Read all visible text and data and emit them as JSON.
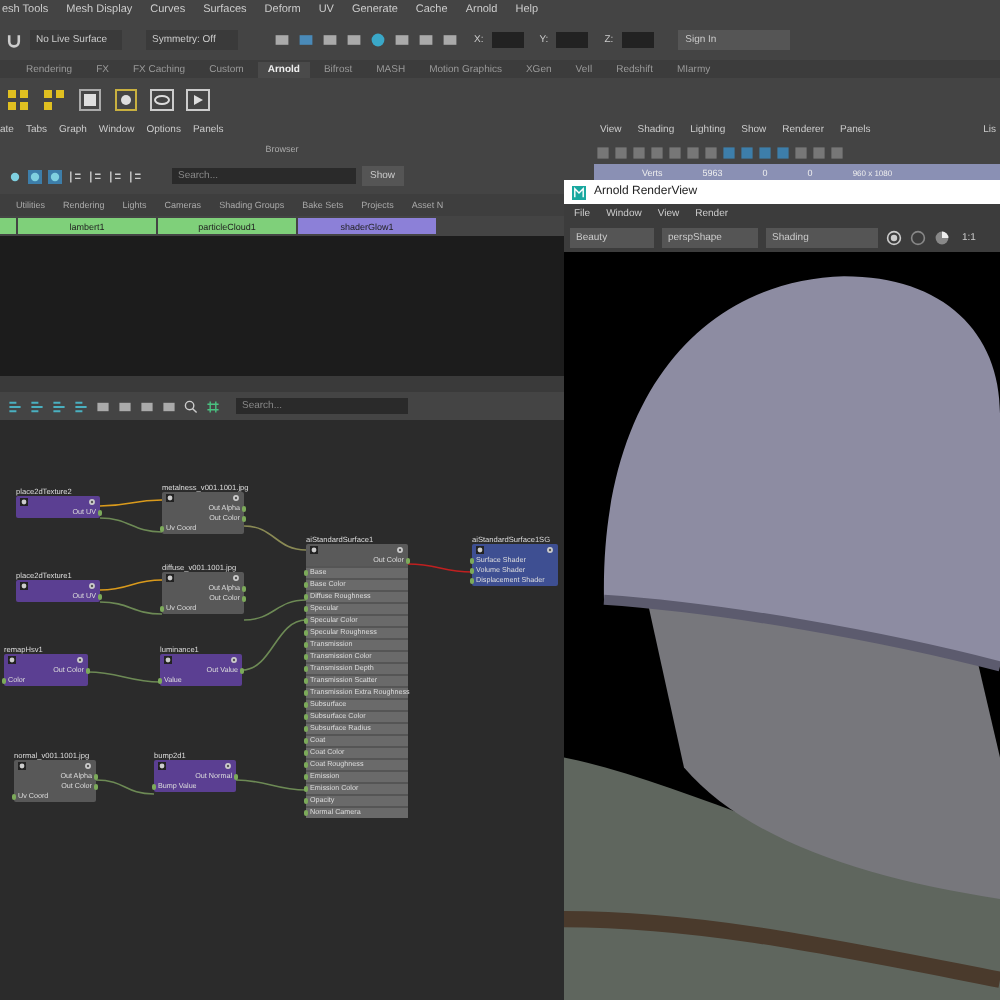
{
  "menu_bar": [
    "esh Tools",
    "Mesh Display",
    "Curves",
    "Surfaces",
    "Deform",
    "UV",
    "Generate",
    "Cache",
    "Arnold",
    "Help"
  ],
  "status_line": {
    "live_surface": "No Live Surface",
    "symmetry": "Symmetry: Off",
    "x_label": "X:",
    "y_label": "Y:",
    "z_label": "Z:",
    "sign_in": "Sign In"
  },
  "shelf_tabs": [
    {
      "label": "Rendering",
      "selected": false
    },
    {
      "label": "FX",
      "selected": false
    },
    {
      "label": "FX Caching",
      "selected": false
    },
    {
      "label": "Custom",
      "selected": false
    },
    {
      "label": "Arnold",
      "selected": true
    },
    {
      "label": "Bifrost",
      "selected": false
    },
    {
      "label": "MASH",
      "selected": false
    },
    {
      "label": "Motion Graphics",
      "selected": false
    },
    {
      "label": "XGen",
      "selected": false
    },
    {
      "label": "VeIl",
      "selected": false
    },
    {
      "label": "Redshift",
      "selected": false
    },
    {
      "label": "MIarmy",
      "selected": false
    }
  ],
  "hypershade": {
    "menu": [
      "ate",
      "Tabs",
      "Graph",
      "Window",
      "Options",
      "Panels"
    ],
    "browser_title": "Browser",
    "search": {
      "placeholder": "Search..."
    },
    "show_button": "Show",
    "browser_tabs": [
      "Utilities",
      "Rendering",
      "Lights",
      "Cameras",
      "Shading Groups",
      "Bake Sets",
      "Projects",
      "Asset N"
    ],
    "swatches": [
      {
        "color": "#7fd07a"
      },
      {
        "label": "lambert1",
        "color": "#7fd07a"
      },
      {
        "label": "particleCloud1",
        "color": "#7fd07a"
      },
      {
        "label": "shaderGlow1",
        "color": "#8c80d8"
      }
    ]
  },
  "node_editor": {
    "search": {
      "placeholder": "Search..."
    },
    "nodes": [
      {
        "name": "place2dTexture2",
        "kind": "utility",
        "ports": [
          {
            "label": "Out UV",
            "kind": "out"
          }
        ]
      },
      {
        "name": "metalness_v001.1001.jpg",
        "kind": "texture",
        "ports": [
          {
            "label": "Out Alpha",
            "kind": "out"
          },
          {
            "label": "Out Color",
            "kind": "out"
          },
          {
            "label": "Uv Coord",
            "kind": "in"
          }
        ]
      },
      {
        "name": "place2dTexture1",
        "kind": "utility",
        "ports": [
          {
            "label": "Out UV",
            "kind": "out"
          }
        ]
      },
      {
        "name": "diffuse_v001.1001.jpg",
        "kind": "texture",
        "ports": [
          {
            "label": "Out Alpha",
            "kind": "out"
          },
          {
            "label": "Out Color",
            "kind": "out"
          },
          {
            "label": "Uv Coord",
            "kind": "in"
          }
        ]
      },
      {
        "name": "aiStandardSurface1",
        "kind": "shader",
        "ports": [
          {
            "label": "Out Color",
            "kind": "out"
          },
          {
            "label": "Base",
            "kind": "in"
          },
          {
            "label": "Base Color",
            "kind": "in"
          },
          {
            "label": "Diffuse Roughness",
            "kind": "in"
          },
          {
            "label": "Specular",
            "kind": "in"
          },
          {
            "label": "Specular Color",
            "kind": "in"
          },
          {
            "label": "Specular Roughness",
            "kind": "in"
          },
          {
            "label": "Transmission",
            "kind": "in"
          },
          {
            "label": "Transmission Color",
            "kind": "in"
          },
          {
            "label": "Transmission Depth",
            "kind": "in"
          },
          {
            "label": "Transmission Scatter",
            "kind": "in"
          },
          {
            "label": "Transmission Extra Roughness",
            "kind": "in"
          },
          {
            "label": "Subsurface",
            "kind": "in"
          },
          {
            "label": "Subsurface Color",
            "kind": "in"
          },
          {
            "label": "Subsurface Radius",
            "kind": "in"
          },
          {
            "label": "Coat",
            "kind": "in"
          },
          {
            "label": "Coat Color",
            "kind": "in"
          },
          {
            "label": "Coat Roughness",
            "kind": "in"
          },
          {
            "label": "Emission",
            "kind": "in"
          },
          {
            "label": "Emission Color",
            "kind": "in"
          },
          {
            "label": "Opacity",
            "kind": "in"
          },
          {
            "label": "Normal Camera",
            "kind": "in"
          }
        ]
      },
      {
        "name": "aiStandardSurface1SG",
        "kind": "group",
        "ports": [
          {
            "label": "Surface Shader",
            "kind": "in"
          },
          {
            "label": "Volume Shader",
            "kind": "in"
          },
          {
            "label": "Displacement Shader",
            "kind": "in"
          }
        ]
      },
      {
        "name": "remapHsv1",
        "kind": "utility",
        "ports": [
          {
            "label": "Out Color",
            "kind": "out"
          },
          {
            "label": "Color",
            "kind": "in"
          }
        ]
      },
      {
        "name": "luminance1",
        "kind": "utility",
        "ports": [
          {
            "label": "Out Value",
            "kind": "out"
          },
          {
            "label": "Value",
            "kind": "in"
          }
        ]
      },
      {
        "name": "normal_v001.1001.jpg",
        "kind": "texture",
        "ports": [
          {
            "label": "Out Alpha",
            "kind": "out"
          },
          {
            "label": "Out Color",
            "kind": "out"
          },
          {
            "label": "Uv Coord",
            "kind": "in"
          }
        ]
      },
      {
        "name": "bump2d1",
        "kind": "utility",
        "ports": [
          {
            "label": "Out Normal",
            "kind": "out"
          },
          {
            "label": "Bump Value",
            "kind": "in"
          }
        ]
      }
    ]
  },
  "viewport": {
    "menu": [
      "View",
      "Shading",
      "Lighting",
      "Show",
      "Renderer",
      "Panels"
    ],
    "hud": {
      "label": "Verts",
      "values": [
        "5963",
        "0",
        "0"
      ],
      "resolution": "960 x 1080"
    },
    "side_panel_label": "Lis"
  },
  "render_view": {
    "title": "Arnold RenderView",
    "menu": [
      "File",
      "Window",
      "View",
      "Render"
    ],
    "aov": "Beauty",
    "camera": "perspShape",
    "mode": "Shading",
    "zoom": "1:1"
  }
}
